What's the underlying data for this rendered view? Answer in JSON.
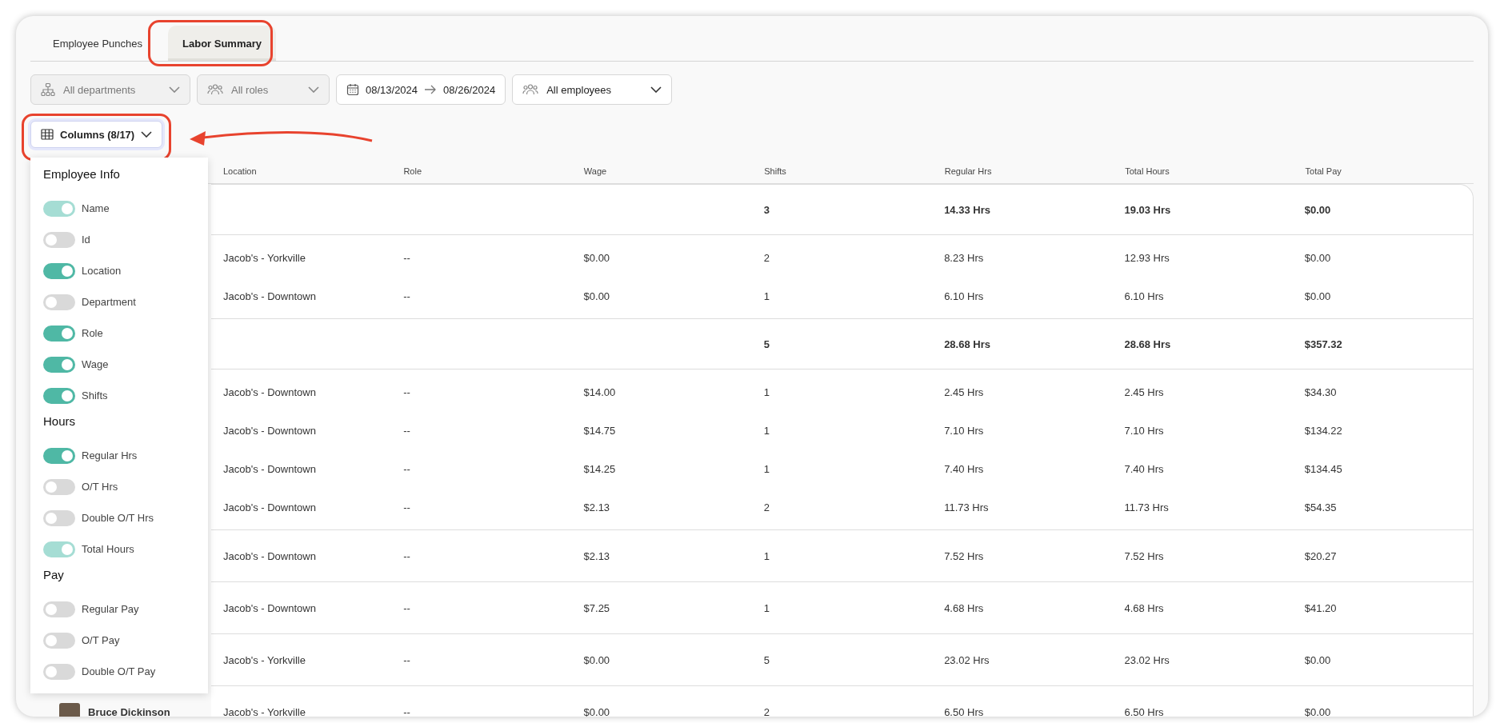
{
  "tabs": [
    {
      "label": "Employee Punches",
      "selected": false
    },
    {
      "label": "Labor Summary",
      "selected": true
    }
  ],
  "filters": [
    {
      "kind": "select",
      "label": "All departments",
      "disabled": true
    },
    {
      "kind": "select",
      "label": "All roles",
      "disabled": true
    },
    {
      "kind": "daterange",
      "start": "08/13/2024",
      "end": "08/26/2024"
    },
    {
      "kind": "select",
      "label": "All employees",
      "disabled": false
    }
  ],
  "columns_button": {
    "label": "Columns (8/17)",
    "expanded": true
  },
  "columns_menu": {
    "sections": [
      {
        "title": "Employee Info",
        "items": [
          {
            "label": "Name",
            "on": true,
            "disabled": true
          },
          {
            "label": "Id",
            "on": false,
            "disabled": false
          },
          {
            "label": "Location",
            "on": true,
            "disabled": false
          },
          {
            "label": "Department",
            "on": false,
            "disabled": false
          },
          {
            "label": "Role",
            "on": true,
            "disabled": false
          },
          {
            "label": "Wage",
            "on": true,
            "disabled": false
          },
          {
            "label": "Shifts",
            "on": true,
            "disabled": false
          }
        ]
      },
      {
        "title": "Hours",
        "items": [
          {
            "label": "Regular Hrs",
            "on": true,
            "disabled": false
          },
          {
            "label": "O/T Hrs",
            "on": false,
            "disabled": false
          },
          {
            "label": "Double O/T Hrs",
            "on": false,
            "disabled": false
          },
          {
            "label": "Total Hours",
            "on": true,
            "disabled": true
          }
        ]
      },
      {
        "title": "Pay",
        "items": [
          {
            "label": "Regular Pay",
            "on": false,
            "disabled": false
          },
          {
            "label": "O/T Pay",
            "on": false,
            "disabled": false
          },
          {
            "label": "Double O/T Pay",
            "on": false,
            "disabled": false
          }
        ]
      }
    ]
  },
  "table": {
    "columns": [
      "Location",
      "Role",
      "Wage",
      "Shifts",
      "Regular Hrs",
      "Total Hours",
      "Total Pay"
    ],
    "groups": [
      {
        "total": {
          "shifts": "3",
          "regular_hrs": "14.33 Hrs",
          "total_hours": "19.03 Hrs",
          "total_pay": "$0.00"
        },
        "rows": [
          {
            "cells": [
              "Jacob's - Yorkville",
              "--",
              "$0.00",
              "2",
              "8.23 Hrs",
              "12.93 Hrs",
              "$0.00"
            ]
          },
          {
            "cells": [
              "Jacob's - Downtown",
              "--",
              "$0.00",
              "1",
              "6.10 Hrs",
              "6.10 Hrs",
              "$0.00"
            ]
          }
        ]
      },
      {
        "total": {
          "shifts": "5",
          "regular_hrs": "28.68 Hrs",
          "total_hours": "28.68 Hrs",
          "total_pay": "$357.32"
        },
        "rows": [
          {
            "cells": [
              "Jacob's - Downtown",
              "--",
              "$14.00",
              "1",
              "2.45 Hrs",
              "2.45 Hrs",
              "$34.30"
            ]
          },
          {
            "cells": [
              "Jacob's - Downtown",
              "--",
              "$14.75",
              "1",
              "7.10 Hrs",
              "7.10 Hrs",
              "$134.22"
            ]
          },
          {
            "cells": [
              "Jacob's - Downtown",
              "--",
              "$14.25",
              "1",
              "7.40 Hrs",
              "7.40 Hrs",
              "$134.45"
            ]
          },
          {
            "cells": [
              "Jacob's - Downtown",
              "--",
              "$2.13",
              "2",
              "11.73 Hrs",
              "11.73 Hrs",
              "$54.35"
            ]
          }
        ]
      },
      {
        "rows": [
          {
            "cells": [
              "Jacob's - Downtown",
              "--",
              "$2.13",
              "1",
              "7.52 Hrs",
              "7.52 Hrs",
              "$20.27"
            ]
          }
        ]
      },
      {
        "rows": [
          {
            "cells": [
              "Jacob's - Downtown",
              "--",
              "$7.25",
              "1",
              "4.68 Hrs",
              "4.68 Hrs",
              "$41.20"
            ]
          }
        ]
      },
      {
        "rows": [
          {
            "cells": [
              "Jacob's - Yorkville",
              "--",
              "$0.00",
              "5",
              "23.02 Hrs",
              "23.02 Hrs",
              "$0.00"
            ]
          }
        ]
      },
      {
        "rows": [
          {
            "name": "Bruce Dickinson",
            "cells": [
              "Jacob's - Yorkville",
              "--",
              "$0.00",
              "2",
              "6.50 Hrs",
              "6.50 Hrs",
              "$0.00"
            ]
          }
        ]
      }
    ]
  }
}
